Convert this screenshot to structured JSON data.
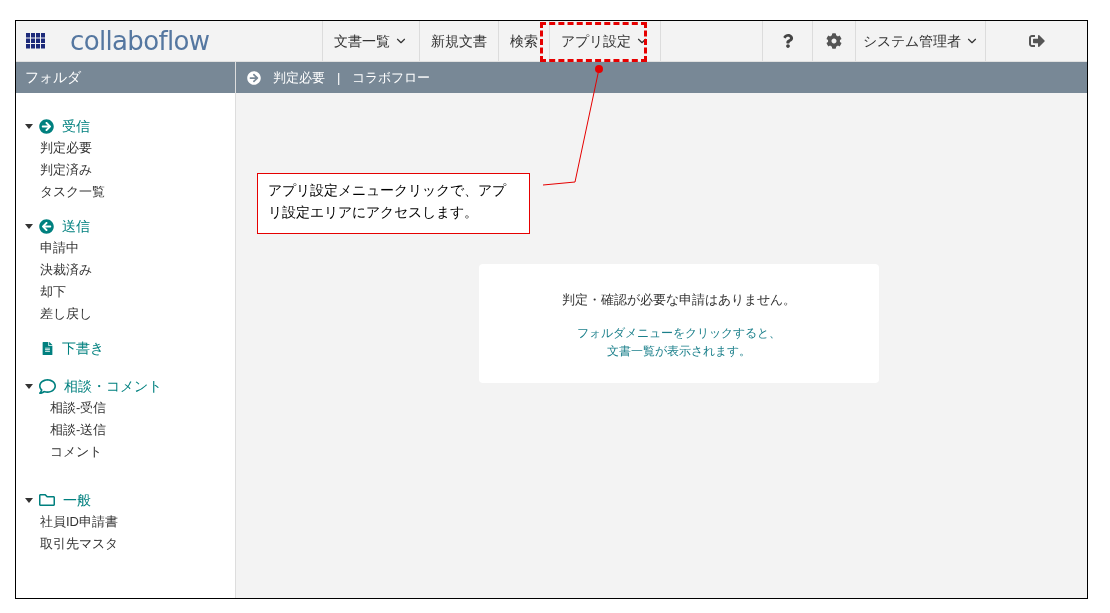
{
  "header": {
    "logo": "collaboflow",
    "nav": [
      {
        "label": "文書一覧",
        "dropdown": true
      },
      {
        "label": "新規文書",
        "dropdown": false
      },
      {
        "label": "検索",
        "dropdown": false
      },
      {
        "label": "アプリ設定",
        "dropdown": true
      }
    ],
    "user": {
      "label": "システム管理者",
      "dropdown": true
    }
  },
  "sidebar": {
    "title": "フォルダ",
    "sections": [
      {
        "kind": "received",
        "label": "受信",
        "expanded": true,
        "children": [
          {
            "label": "判定必要"
          },
          {
            "label": "判定済み"
          },
          {
            "label": "タスク一覧"
          }
        ]
      },
      {
        "kind": "sent",
        "label": "送信",
        "expanded": true,
        "children": [
          {
            "label": "申請中"
          },
          {
            "label": "決裁済み"
          },
          {
            "label": "却下"
          },
          {
            "label": "差し戻し"
          }
        ]
      },
      {
        "kind": "draft",
        "label": "下書き"
      },
      {
        "kind": "discussion",
        "label": "相談・コメント",
        "expanded": true,
        "children": [
          {
            "label": "相談-受信"
          },
          {
            "label": "相談-送信"
          },
          {
            "label": "コメント"
          }
        ]
      },
      {
        "kind": "folder",
        "label": "一般",
        "expanded": true,
        "children": [
          {
            "label": "社員ID申請書"
          },
          {
            "label": "取引先マスタ"
          }
        ]
      }
    ]
  },
  "breadcrumb": {
    "current": "判定必要",
    "separator": "|",
    "app": "コラボフロー"
  },
  "empty_state": {
    "message": "判定・確認が必要な申請はありません。",
    "hint_lines": [
      "フォルダメニューをクリックすると、",
      "文書一覧が表示されます。"
    ]
  },
  "callout": {
    "text": "アプリ設定メニュークリックで、アプリ設定エリアにアクセスします。"
  }
}
